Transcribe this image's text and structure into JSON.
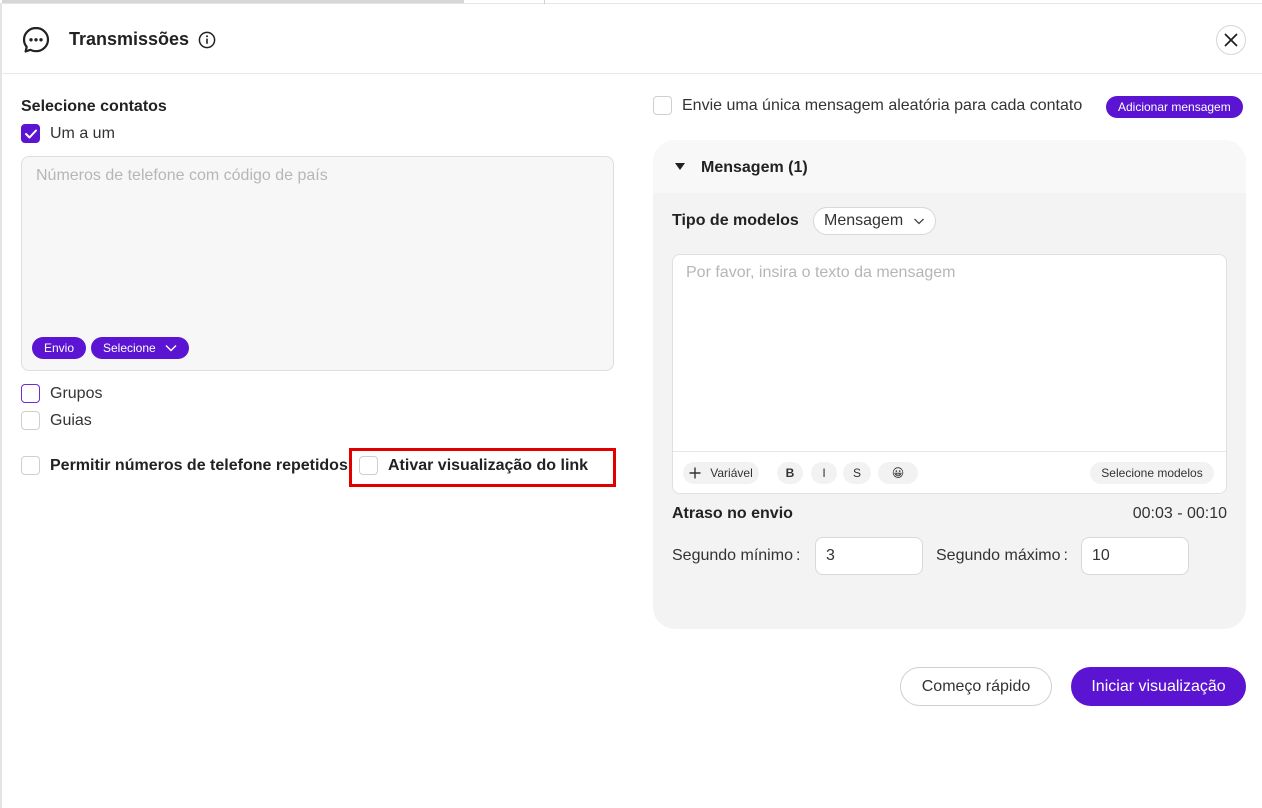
{
  "header": {
    "title": "Transmissões"
  },
  "contacts": {
    "title": "Selecione contatos",
    "one_by_one": "Um a um",
    "phone_placeholder": "Números de telefone com código de país",
    "send_label": "Envio",
    "select_label": "Selecione",
    "groups": "Grupos",
    "tabs": "Guias",
    "allow_repeated": "Permitir números de telefone repetidos",
    "link_preview": "Ativar visualização do link"
  },
  "message_options": {
    "random_message": "Envie uma única mensagem aleatória para cada contato",
    "add_message": "Adicionar mensagem"
  },
  "message_panel": {
    "title": "Mensagem (1)",
    "template_type_label": "Tipo de modelos",
    "template_type_value": "Mensagem",
    "text_placeholder": "Por favor, insira o texto da mensagem",
    "toolbar": {
      "variable": "Variável",
      "bold": "B",
      "italic": "I",
      "strike": "S",
      "emoji": "😀",
      "select_templates": "Selecione modelos"
    },
    "delay_label": "Atraso no envio",
    "delay_range": "00:03 - 00:10",
    "min_label": "Segundo mínimo",
    "min_value": "3",
    "max_label": "Segundo máximo",
    "max_value": "10"
  },
  "footer": {
    "quick_start": "Começo rápido",
    "start_preview": "Iniciar visualização"
  },
  "colors": {
    "accent": "#5b14d1",
    "highlight": "#e10000"
  }
}
